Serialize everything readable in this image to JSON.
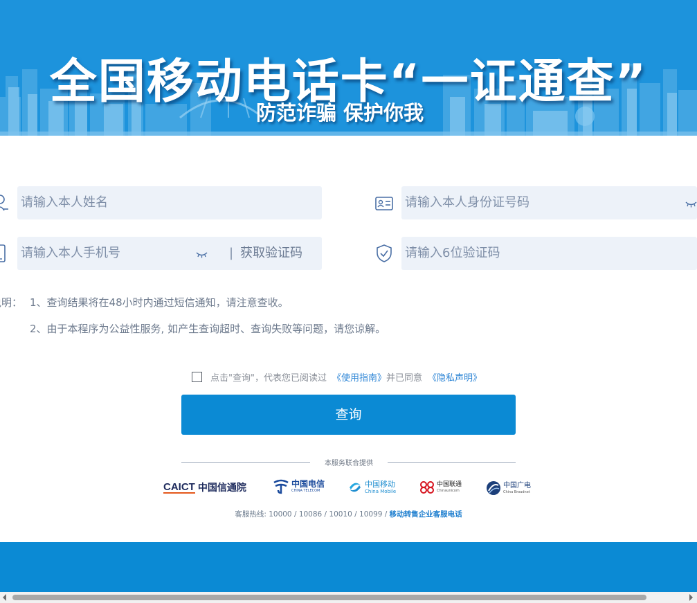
{
  "banner": {
    "title": "全国移动电话卡“一证通查”",
    "subtitle": "防范诈骗 保护你我"
  },
  "form": {
    "name_placeholder": "请输入本人姓名",
    "id_placeholder": "请输入本人身份证号码",
    "phone_placeholder": "请输入本人手机号",
    "get_code_label": "获取验证码",
    "code_placeholder": "请输入6位验证码",
    "divider": "|"
  },
  "notes": {
    "label": "说明：",
    "items": [
      "1、查询结果将在48小时内通过短信通知，请注意查收。",
      "2、由于本程序为公益性服务, 如产生查询超时、查询失败等问题，请您谅解。"
    ]
  },
  "agreement": {
    "text_before": "点击\"查询\"，代表您已阅读过",
    "guide_link": "《使用指南》",
    "text_middle": "并已同意",
    "privacy_link": "《隐私声明》",
    "checked": false
  },
  "submit_label": "查询",
  "providers": {
    "heading": "本服务联合提供",
    "logos": [
      {
        "name": "caict",
        "abbr": "CAICT",
        "cn": "中国信通院"
      },
      {
        "name": "china-telecom",
        "cn": "中国电信",
        "en": "CHINA TELECOM"
      },
      {
        "name": "china-mobile",
        "cn": "中国移动",
        "en": "China Mobile"
      },
      {
        "name": "china-unicom",
        "cn": "中国联通",
        "en": "Chinaunicom"
      },
      {
        "name": "china-broadnet",
        "cn": "中国广电",
        "en": "China Broadnet"
      }
    ]
  },
  "hotline": {
    "text": "客服热线: 10000 / 10086 / 10010 / 10099 / ",
    "link": "移动转售企业客服电话"
  },
  "colors": {
    "banner_blue": "#1d93dc",
    "primary_blue": "#0b8ad4",
    "input_bg": "#edf2f9",
    "link_blue": "#2f86d6"
  }
}
